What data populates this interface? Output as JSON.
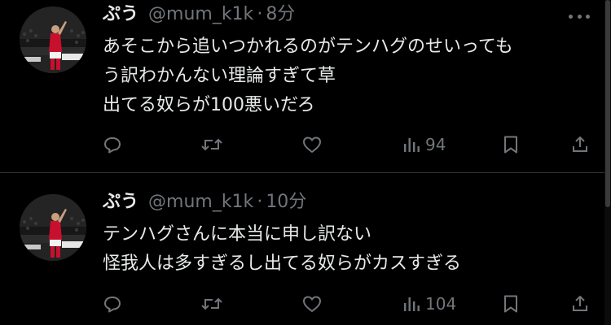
{
  "tweets": [
    {
      "display_name": "ぷう",
      "handle": "@mum_k1k",
      "separator": "·",
      "time": "8分",
      "lines": [
        "あそこから追いつかれるのがテンハグのせいっても",
        "う訳わかんない理論すぎて草",
        "出てる奴らが100悪いだろ"
      ],
      "views": "94",
      "avatar_icon": "avatar-player-photo",
      "colors": {
        "kit": "#c8102e"
      }
    },
    {
      "display_name": "ぷう",
      "handle": "@mum_k1k",
      "separator": "·",
      "time": "10分",
      "lines": [
        "テンハグさんに本当に申し訳ない",
        "怪我人は多すぎるし出てる奴らがカスすぎる"
      ],
      "views": "104",
      "avatar_icon": "avatar-player-photo",
      "colors": {
        "kit": "#c8102e"
      }
    }
  ],
  "icons": {
    "reply": "reply-icon",
    "retweet": "retweet-icon",
    "like": "heart-icon",
    "views": "views-icon",
    "bookmark": "bookmark-icon",
    "share": "share-icon",
    "more": "more-icon"
  },
  "theme": {
    "background": "#000000",
    "text": "#e7e9ea",
    "muted": "#71767b",
    "divider": "#2f3336"
  }
}
